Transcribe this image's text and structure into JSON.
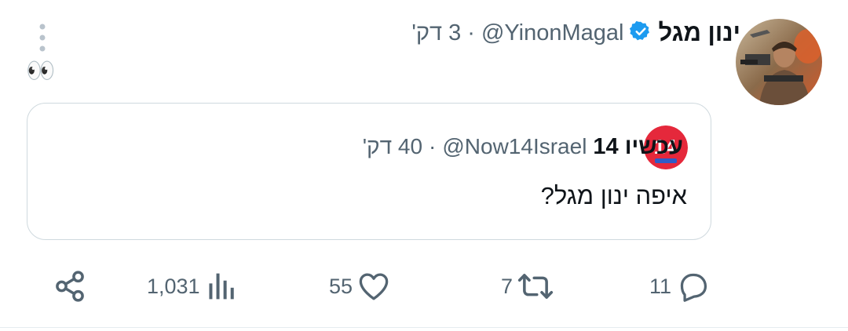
{
  "tweet": {
    "author_name": "ינון מגל",
    "handle": "@YinonMagal",
    "separator": "·",
    "time": "3 דק'",
    "text": "👀",
    "verified_color": "#1d9bf0"
  },
  "quote": {
    "author_name": "עכשיו 14",
    "handle": "@Now14Israel",
    "separator": "·",
    "time": "40 דק'",
    "text": "איפה ינון מגל?",
    "logo_text": "14",
    "logo_color": "#e5283b"
  },
  "actions": {
    "replies": "11",
    "retweets": "7",
    "likes": "55",
    "views": "1,031"
  },
  "icons": [
    "more-vertical-icon",
    "verified-badge-icon",
    "reply-icon",
    "retweet-icon",
    "like-icon",
    "views-icon",
    "share-icon"
  ]
}
